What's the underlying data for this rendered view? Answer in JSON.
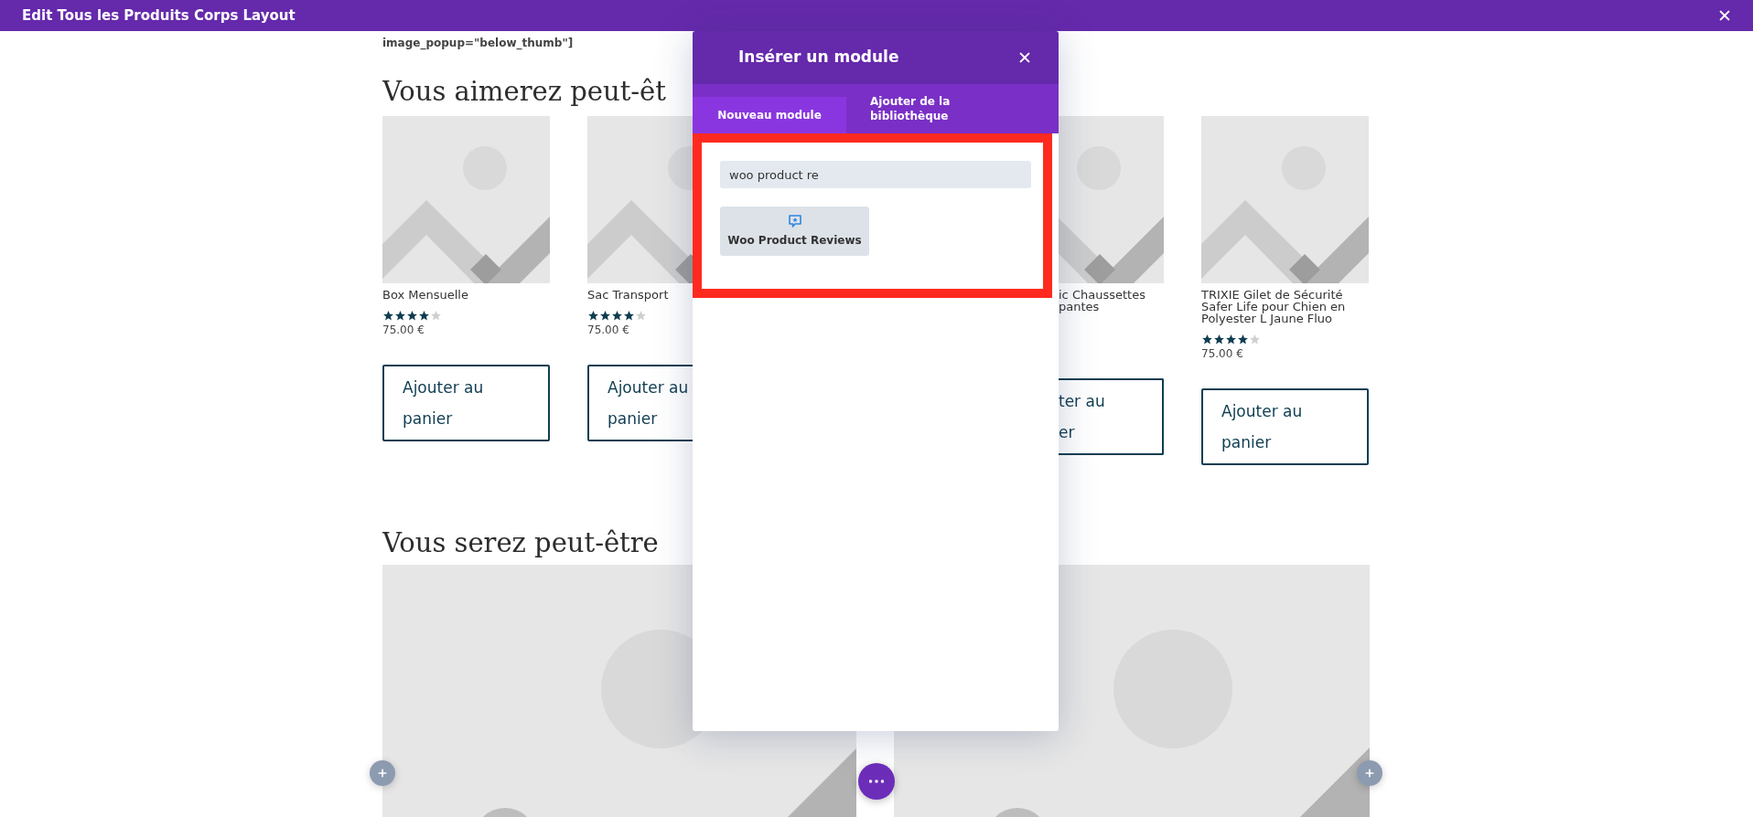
{
  "top_bar": {
    "title": "Edit Tous les Produits Corps Layout"
  },
  "shortcode_tail": "image_popup=\"below_thumb\"]",
  "section_1": {
    "heading": "Vous aimerez peut-êt",
    "products": [
      {
        "kind": "card",
        "title": "Box Mensuelle",
        "stars": 4,
        "price": "75.00 €",
        "button": "Ajouter au panier"
      },
      {
        "kind": "card",
        "title": "Sac Transport",
        "stars": 4,
        "price": "75.00 €",
        "button": "Ajouter au panier"
      },
      {
        "kind": "clipped",
        "title_lines": [
          "ic Chaussettes",
          "pantes"
        ],
        "button_lines": [
          "ter au",
          "er"
        ]
      },
      {
        "kind": "card",
        "title": "TRIXIE Gilet de Sécurité Safer Life pour Chien en Polyester L Jaune Fluo",
        "stars": 4,
        "price": "75.00 €",
        "button": "Ajouter au panier"
      }
    ]
  },
  "section_2": {
    "heading": "Vous serez peut-être"
  },
  "modal": {
    "title": "Insérer un module",
    "tabs": [
      {
        "label": "Nouveau module",
        "selected": true
      },
      {
        "label": "Ajouter de la bibliothèque",
        "selected": false
      }
    ],
    "search": {
      "value": "woo product re"
    },
    "results": [
      {
        "label": "Woo Product Reviews"
      }
    ]
  }
}
